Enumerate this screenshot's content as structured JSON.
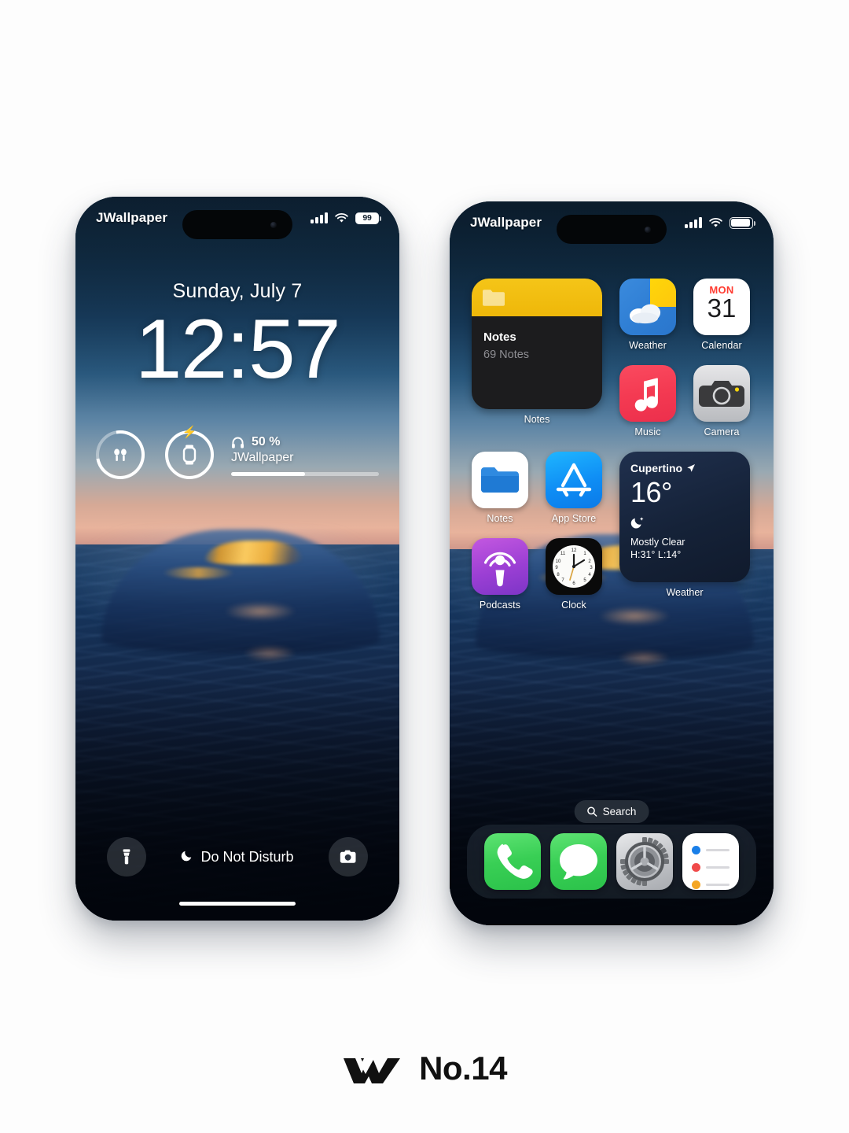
{
  "lock_screen": {
    "status_bar": {
      "carrier": "JWallpaper",
      "signal_icon": "cellular-bars-icon",
      "wifi_icon": "wifi-icon",
      "battery_icon": "battery-icon",
      "battery_level": "99"
    },
    "date": "Sunday, July 7",
    "time": "12:57",
    "widgets": [
      {
        "name": "airpods-battery-ring",
        "icon": "airpods-icon",
        "progress": 82
      },
      {
        "name": "apple-watch-charging-ring",
        "icon": "apple-watch-icon",
        "progress": 100,
        "badge_icon": "bolt-icon"
      }
    ],
    "media": {
      "icon": "headphones-icon",
      "percent": "50 %",
      "title": "JWallpaper",
      "progress": 50
    },
    "bottom": {
      "flashlight_icon": "flashlight-icon",
      "camera_icon": "camera-icon",
      "focus_icon": "moon-icon",
      "focus_label": "Do Not Disturb"
    }
  },
  "home_screen": {
    "status_bar": {
      "carrier": "JWallpaper",
      "signal_icon": "cellular-bars-icon",
      "wifi_icon": "wifi-icon",
      "battery_icon": "battery-icon",
      "battery_level": ""
    },
    "notes_widget": {
      "folder_icon": "folder-icon",
      "title": "Notes",
      "subtitle": "69 Notes",
      "label": "Notes"
    },
    "weather_widget": {
      "city": "Cupertino",
      "location_icon": "location-arrow-icon",
      "temperature": "16°",
      "condition_icon": "moon-stars-icon",
      "condition": "Mostly Clear",
      "high_low": "H:31° L:14°",
      "label": "Weather"
    },
    "apps_col3": [
      {
        "name": "weather",
        "label": "Weather",
        "icon": "weather-icon"
      },
      {
        "name": "calendar",
        "label": "Calendar",
        "icon": "calendar-icon",
        "weekday": "MON",
        "day": "31"
      },
      {
        "name": "music",
        "label": "Music",
        "icon": "music-note-icon"
      },
      {
        "name": "camera",
        "label": "Camera",
        "icon": "camera-icon"
      }
    ],
    "apps_row2": [
      {
        "name": "notes",
        "label": "Notes",
        "icon": "notes-folder-icon"
      },
      {
        "name": "app-store",
        "label": "App Store",
        "icon": "app-store-icon"
      },
      {
        "name": "podcasts",
        "label": "Podcasts",
        "icon": "podcasts-icon"
      },
      {
        "name": "clock",
        "label": "Clock",
        "icon": "clock-icon"
      }
    ],
    "search": {
      "icon": "search-icon",
      "label": "Search"
    },
    "dock": [
      {
        "name": "phone",
        "label": "Phone",
        "icon": "phone-handset-icon"
      },
      {
        "name": "messages",
        "label": "Messages",
        "icon": "message-bubble-icon"
      },
      {
        "name": "settings",
        "label": "Settings",
        "icon": "gear-icon"
      },
      {
        "name": "reminders",
        "label": "Reminders",
        "icon": "reminders-list-icon"
      }
    ]
  },
  "footer": {
    "logo_icon": "w-logo-icon",
    "text": "No.14"
  },
  "colors": {
    "page_background": "#fdfdfd",
    "notes_yellow": "#f5c518",
    "music_red": "#f43a52",
    "calendar_red": "#ff3b30",
    "app_store_blue": "#0f8ef5",
    "podcasts_purple": "#9b3fd4",
    "phone_green": "#39cf55",
    "widget_dark": "#1c1c1e"
  }
}
